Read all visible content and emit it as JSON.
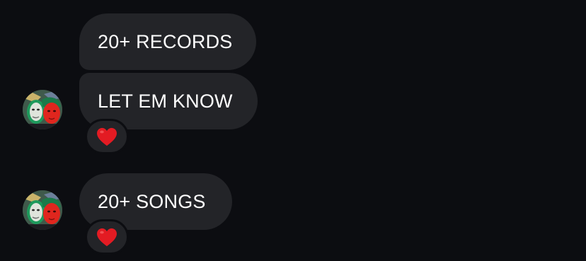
{
  "messages": [
    {
      "text": "20+ RECORDS",
      "reaction": null
    },
    {
      "text": "LET EM KNOW",
      "reaction": "red-heart"
    },
    {
      "text": "20+ SONGS",
      "reaction": "red-heart"
    }
  ],
  "colors": {
    "background": "#0c0d11",
    "bubble": "#232428",
    "text": "#ffffff",
    "heart": "#e31b23"
  },
  "avatar": {
    "icon": "masks-avatar"
  }
}
